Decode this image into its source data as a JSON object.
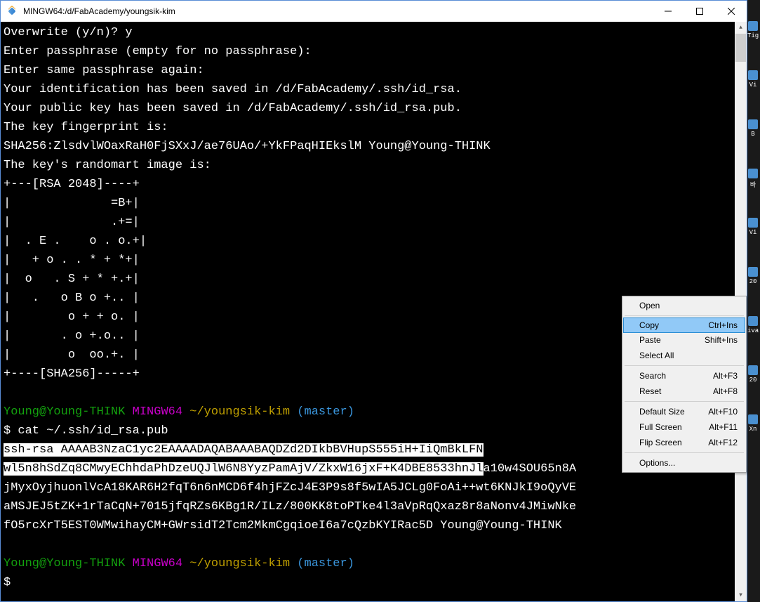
{
  "titlebar": {
    "title": "MINGW64:/d/FabAcademy/youngsik-kim"
  },
  "terminal": {
    "lines": [
      {
        "t": "plain",
        "text": "Overwrite (y/n)? y"
      },
      {
        "t": "plain",
        "text": "Enter passphrase (empty for no passphrase):"
      },
      {
        "t": "plain",
        "text": "Enter same passphrase again:"
      },
      {
        "t": "plain",
        "text": "Your identification has been saved in /d/FabAcademy/.ssh/id_rsa."
      },
      {
        "t": "plain",
        "text": "Your public key has been saved in /d/FabAcademy/.ssh/id_rsa.pub."
      },
      {
        "t": "plain",
        "text": "The key fingerprint is:"
      },
      {
        "t": "plain",
        "text": "SHA256:ZlsdvlWOaxRaH0FjSXxJ/ae76UAo/+YkFPaqHIEkslM Young@Young-THINK"
      },
      {
        "t": "plain",
        "text": "The key's randomart image is:"
      },
      {
        "t": "plain",
        "text": "+---[RSA 2048]----+"
      },
      {
        "t": "plain",
        "text": "|              =B+|"
      },
      {
        "t": "plain",
        "text": "|              .+=|"
      },
      {
        "t": "plain",
        "text": "|  . E .    o . o.+|"
      },
      {
        "t": "plain",
        "text": "|   + o . . * + *+|"
      },
      {
        "t": "plain",
        "text": "|  o   . S + * +.+|"
      },
      {
        "t": "plain",
        "text": "|   .   o B o +.. |"
      },
      {
        "t": "plain",
        "text": "|        o + + o. |"
      },
      {
        "t": "plain",
        "text": "|       . o +.o.. |"
      },
      {
        "t": "plain",
        "text": "|        o  oo.+. |"
      },
      {
        "t": "plain",
        "text": "+----[SHA256]-----+"
      },
      {
        "t": "blank",
        "text": " "
      },
      {
        "t": "prompt1",
        "user": "Young@Young-THINK",
        "sys": "MINGW64",
        "path": "~/youngsik-kim",
        "branch": "(master)"
      },
      {
        "t": "cmd",
        "text": "$ cat ~/.ssh/id_rsa.pub"
      },
      {
        "t": "sel",
        "text": "ssh-rsa AAAAB3NzaC1yc2EAAAADAQABAAABAQDZd2DIkbBVHupS555iH+IiQmBkLFN"
      },
      {
        "t": "selpartial",
        "sel": "wl5n8hSdZq8CMwyEChhdaPhDzeUQJlW6N8YyzPamAjV/ZkxW16jxF+K4DBE8533hnJl",
        "rest": "a10w4SOU65n8A"
      },
      {
        "t": "unsel",
        "text": "jMyxOyjhuonlVcA18KAR6H2fqT6n6nMCD6f4hjFZcJ4E3P9s8f5wIA5JCLg0FoAi++wt6KNJkI9oQyVE"
      },
      {
        "t": "unsel",
        "text": "aMSJEJ5tZK+1rTaCqN+7015jfqRZs6KBg1R/ILz/800KK8toPTke4l3aVpRqQxaz8r8aNonv4JMiwNke"
      },
      {
        "t": "unsel",
        "text": "fO5rcXrT5EST0WMwihayCM+GWrsidT2Tcm2MkmCgqioeI6a7cQzbKYIRac5D Young@Young-THINK"
      },
      {
        "t": "blank",
        "text": " "
      },
      {
        "t": "prompt1",
        "user": "Young@Young-THINK",
        "sys": "MINGW64",
        "path": "~/youngsik-kim",
        "branch": "(master)"
      },
      {
        "t": "cmd",
        "text": "$"
      }
    ]
  },
  "contextmenu": {
    "items": [
      {
        "label": "Open",
        "shortcut": ""
      },
      {
        "sep": true
      },
      {
        "label": "Copy",
        "shortcut": "Ctrl+Ins",
        "selected": true
      },
      {
        "label": "Paste",
        "shortcut": "Shift+Ins"
      },
      {
        "label": "Select All",
        "shortcut": ""
      },
      {
        "sep": true
      },
      {
        "label": "Search",
        "shortcut": "Alt+F3"
      },
      {
        "label": "Reset",
        "shortcut": "Alt+F8"
      },
      {
        "sep": true
      },
      {
        "label": "Default Size",
        "shortcut": "Alt+F10"
      },
      {
        "label": "Full Screen",
        "shortcut": "Alt+F11"
      },
      {
        "label": "Flip Screen",
        "shortcut": "Alt+F12"
      },
      {
        "sep": true
      },
      {
        "label": "Options...",
        "shortcut": ""
      }
    ]
  },
  "desktopIcons": [
    "Tig",
    "Vi",
    "B ",
    "바",
    "Vi",
    "20",
    "iva",
    "20",
    "Xn"
  ]
}
